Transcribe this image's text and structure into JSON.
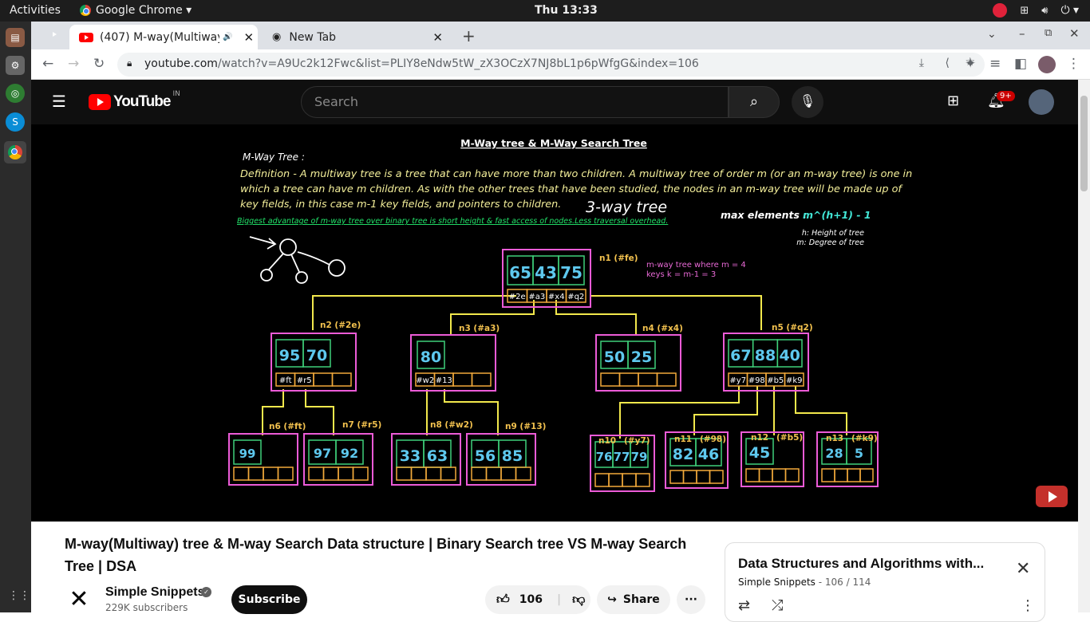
{
  "topbar": {
    "activities": "Activities",
    "app": "Google Chrome ▾",
    "clock": "Thu 13:33"
  },
  "tabs": [
    {
      "title": "(407) M-way(Multiway",
      "audio": "🔊"
    },
    {
      "title": "New Tab"
    }
  ],
  "address": {
    "host": "youtube.com",
    "path": "/watch?v=A9Uc2k12Fwc&list=PLIY8eNdw5tW_zX3OCzX7NJ8bL1p6pWfgG&index=106"
  },
  "youtube": {
    "logo": "YouTube",
    "region": "IN",
    "search_placeholder": "Search",
    "notif_count": "9+"
  },
  "slide": {
    "title": "M-Way tree & M-Way Search Tree",
    "subtitle": "M-Way Tree :",
    "def1": "Definition - A multiway tree is a tree that can have more than two children. A multiway tree of order m (or an m-way tree) is one in",
    "def2": "which a tree can have m children. As with the other trees that have been studied, the nodes in an m-way tree will be made up of",
    "def3": "key fields, in this case m-1 key fields, and pointers to children.",
    "handwriting": "3-way tree",
    "maxel": "max elements : ",
    "maxel_formula": "m^(h+1) - 1",
    "advantage": "Biggest advantage of m-way tree over binary tree is short height & fast access of nodes.Less traversal overhead.",
    "h_note": "h: Height of tree",
    "m_note": "m: Degree of tree",
    "mway_note1": "m-way tree where m = 4",
    "mway_note2": "keys k = m-1 = 3",
    "nodes": {
      "n1": {
        "label": "n1 (#fe)",
        "keys": [
          "65",
          "43",
          "75"
        ],
        "ptrs": [
          "#2e",
          "#a3",
          "#x4",
          "#q2"
        ]
      },
      "n2": {
        "label": "n2 (#2e)",
        "keys": [
          "95",
          "70"
        ],
        "ptrs": [
          "#ft",
          "#r5",
          "",
          ""
        ]
      },
      "n3": {
        "label": "n3 (#a3)",
        "keys": [
          "80"
        ],
        "ptrs": [
          "#w2",
          "#13",
          "",
          ""
        ]
      },
      "n4": {
        "label": "n4 (#x4)",
        "keys": [
          "50",
          "25"
        ],
        "ptrs": [
          "",
          "",
          "",
          ""
        ]
      },
      "n5": {
        "label": "n5 (#q2)",
        "keys": [
          "67",
          "88",
          "40"
        ],
        "ptrs": [
          "#y7",
          "#98",
          "#b5",
          "#k9"
        ]
      },
      "n6": {
        "label": "n6 (#ft)",
        "keys": [
          "99"
        ]
      },
      "n7": {
        "label": "n7 (#r5)",
        "keys": [
          "97",
          "92"
        ]
      },
      "n8": {
        "label": "n8 (#w2)",
        "keys": [
          "33",
          "63"
        ]
      },
      "n9": {
        "label": "n9 (#13)",
        "keys": [
          "56",
          "85"
        ]
      },
      "n10": {
        "label": "n10",
        "label2": "(#y7)",
        "keys": [
          "76",
          "77",
          "79"
        ]
      },
      "n11": {
        "label": "n11",
        "label2": "(#98)",
        "keys": [
          "82",
          "46"
        ]
      },
      "n12": {
        "label": "n12",
        "label2": "(#b5)",
        "keys": [
          "45"
        ]
      },
      "n13": {
        "label": "n13",
        "label2": "(#k9)",
        "keys": [
          "28",
          "5"
        ]
      }
    }
  },
  "video_info": {
    "title": "M-way(Multiway) tree & M-way Search Data structure | Binary Search tree VS M-way Search Tree | DSA",
    "channel": "Simple Snippets",
    "subscribers": "229K subscribers",
    "subscribe": "Subscribe",
    "likes": "106",
    "share": "Share"
  },
  "playlist": {
    "title": "Data Structures and Algorithms with...",
    "channel": "Simple Snippets",
    "position": "- 106 / 114"
  }
}
